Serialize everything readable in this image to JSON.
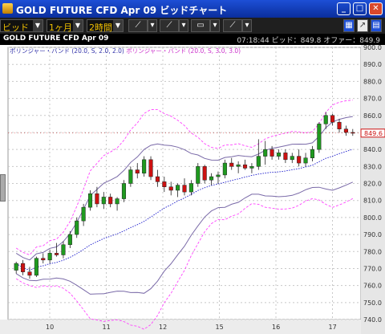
{
  "window": {
    "title": "GOLD FUTURE CFD Apr 09 ビッドチャート",
    "minimize_glyph": "_",
    "maximize_glyph": "□",
    "close_glyph": "✕"
  },
  "toolbar": {
    "price_type": "ビッド",
    "period": "1ヶ月",
    "interval": "2時間"
  },
  "infobar": {
    "chart_title": "GOLD FUTURE CFD Apr 09",
    "price_info": "07:18:44  ビッド：849.8  オファー：849.9"
  },
  "legend": {
    "band1": "ボリンジャー・バンド (20.0, S, 2.0, 2.0)",
    "band2": "ボリンジャー・バンド (20.0, S, 3.0, 3.0)"
  },
  "colors": {
    "up_candle": "#1f9a1f",
    "down_candle": "#cc1111",
    "band_2sd": "#7a6aa8",
    "band_3sd": "#ff44ff",
    "middle_band": "#1a1acc",
    "current_price": "#cc1111"
  },
  "icons": [
    "drawing-line-icon",
    "line-tools-icon",
    "indicator-icon",
    "print-icon",
    "chart-type-icon",
    "grid-layout-icon",
    "chart-settings-icon",
    "window-menu-icon"
  ],
  "chart_data": {
    "type": "candlestick",
    "ylim": [
      740,
      900
    ],
    "y_ticks": [
      "740.0",
      "750.0",
      "760.0",
      "770.0",
      "780.0",
      "790.0",
      "800.0",
      "810.0",
      "820.0",
      "830.0",
      "840.0",
      "850.0",
      "860.0",
      "870.0",
      "880.0",
      "890.0",
      "900.0"
    ],
    "x_ticks": [
      "10",
      "11",
      "12",
      "15",
      "16",
      "17"
    ],
    "current_price_label": "849.6",
    "candles": [
      {
        "o": 769,
        "h": 774,
        "l": 767,
        "c": 773
      },
      {
        "o": 773,
        "h": 775,
        "l": 766,
        "c": 768
      },
      {
        "o": 768,
        "h": 771,
        "l": 764,
        "c": 766
      },
      {
        "o": 766,
        "h": 777,
        "l": 765,
        "c": 776
      },
      {
        "o": 776,
        "h": 779,
        "l": 773,
        "c": 775
      },
      {
        "o": 775,
        "h": 781,
        "l": 773,
        "c": 779
      },
      {
        "o": 779,
        "h": 785,
        "l": 777,
        "c": 778
      },
      {
        "o": 778,
        "h": 786,
        "l": 776,
        "c": 784
      },
      {
        "o": 784,
        "h": 792,
        "l": 782,
        "c": 790
      },
      {
        "o": 790,
        "h": 800,
        "l": 788,
        "c": 798
      },
      {
        "o": 798,
        "h": 808,
        "l": 795,
        "c": 806
      },
      {
        "o": 806,
        "h": 816,
        "l": 804,
        "c": 814
      },
      {
        "o": 814,
        "h": 818,
        "l": 806,
        "c": 808
      },
      {
        "o": 808,
        "h": 815,
        "l": 805,
        "c": 812
      },
      {
        "o": 812,
        "h": 814,
        "l": 806,
        "c": 808
      },
      {
        "o": 808,
        "h": 812,
        "l": 804,
        "c": 811
      },
      {
        "o": 811,
        "h": 822,
        "l": 809,
        "c": 820
      },
      {
        "o": 820,
        "h": 830,
        "l": 818,
        "c": 828
      },
      {
        "o": 828,
        "h": 832,
        "l": 823,
        "c": 826
      },
      {
        "o": 826,
        "h": 836,
        "l": 824,
        "c": 834
      },
      {
        "o": 834,
        "h": 836,
        "l": 822,
        "c": 824
      },
      {
        "o": 824,
        "h": 828,
        "l": 818,
        "c": 821
      },
      {
        "o": 821,
        "h": 824,
        "l": 815,
        "c": 818
      },
      {
        "o": 818,
        "h": 821,
        "l": 813,
        "c": 816
      },
      {
        "o": 816,
        "h": 820,
        "l": 812,
        "c": 819
      },
      {
        "o": 819,
        "h": 823,
        "l": 813,
        "c": 815
      },
      {
        "o": 815,
        "h": 822,
        "l": 813,
        "c": 820
      },
      {
        "o": 820,
        "h": 832,
        "l": 818,
        "c": 830
      },
      {
        "o": 830,
        "h": 831,
        "l": 820,
        "c": 822
      },
      {
        "o": 822,
        "h": 826,
        "l": 819,
        "c": 824
      },
      {
        "o": 824,
        "h": 827,
        "l": 820,
        "c": 825
      },
      {
        "o": 825,
        "h": 834,
        "l": 823,
        "c": 832
      },
      {
        "o": 832,
        "h": 835,
        "l": 828,
        "c": 830
      },
      {
        "o": 830,
        "h": 833,
        "l": 826,
        "c": 831
      },
      {
        "o": 831,
        "h": 834,
        "l": 828,
        "c": 829
      },
      {
        "o": 829,
        "h": 832,
        "l": 826,
        "c": 830
      },
      {
        "o": 830,
        "h": 846,
        "l": 828,
        "c": 836
      },
      {
        "o": 836,
        "h": 845,
        "l": 831,
        "c": 840
      },
      {
        "o": 840,
        "h": 842,
        "l": 834,
        "c": 836
      },
      {
        "o": 836,
        "h": 840,
        "l": 834,
        "c": 838
      },
      {
        "o": 838,
        "h": 840,
        "l": 832,
        "c": 834
      },
      {
        "o": 834,
        "h": 838,
        "l": 832,
        "c": 836
      },
      {
        "o": 836,
        "h": 840,
        "l": 830,
        "c": 832
      },
      {
        "o": 832,
        "h": 838,
        "l": 830,
        "c": 835
      },
      {
        "o": 835,
        "h": 842,
        "l": 833,
        "c": 840
      },
      {
        "o": 840,
        "h": 856,
        "l": 838,
        "c": 855
      },
      {
        "o": 855,
        "h": 862,
        "l": 852,
        "c": 860
      },
      {
        "o": 860,
        "h": 861,
        "l": 854,
        "c": 856
      },
      {
        "o": 856,
        "h": 858,
        "l": 850,
        "c": 852
      },
      {
        "o": 852,
        "h": 854,
        "l": 848,
        "c": 850
      },
      {
        "o": 850,
        "h": 852,
        "l": 848,
        "c": 849.6
      }
    ]
  }
}
